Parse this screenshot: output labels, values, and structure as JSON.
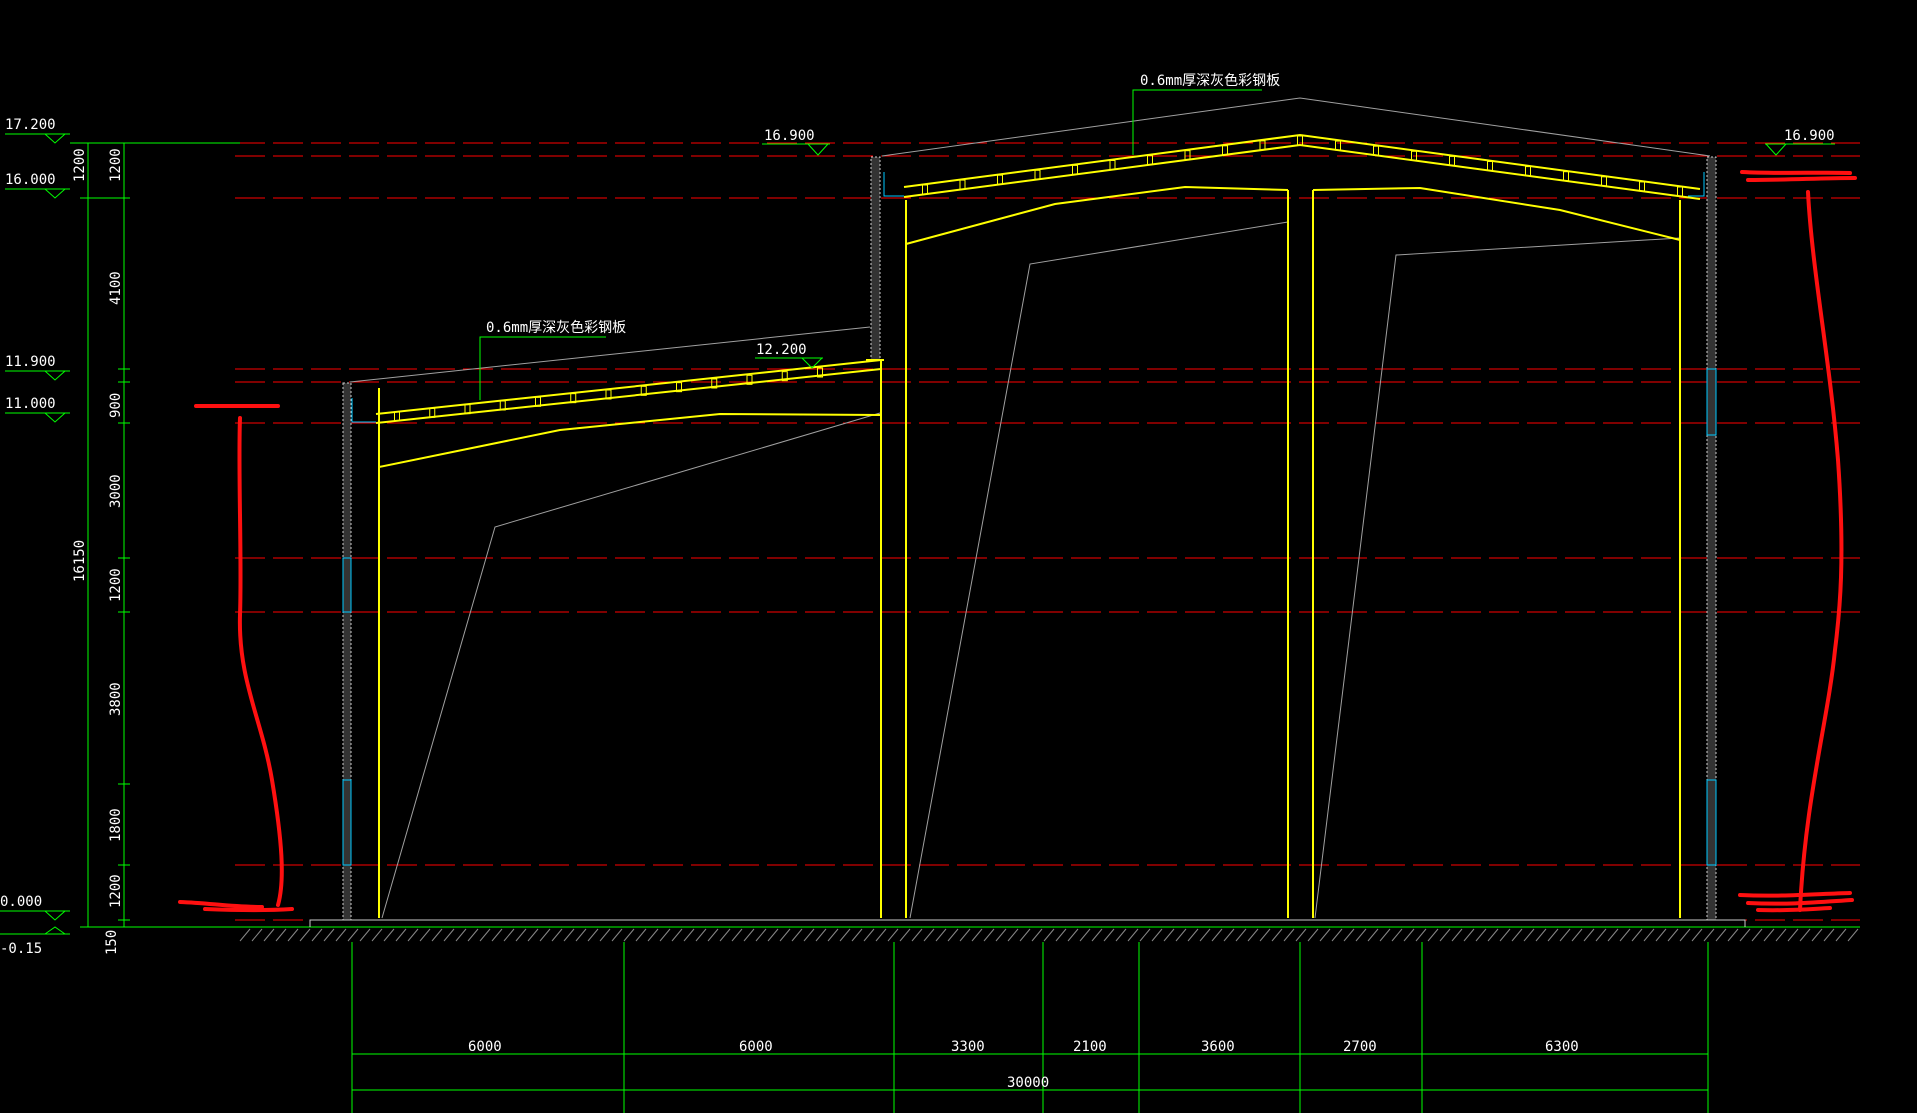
{
  "drawing": {
    "colors": {
      "background": "#000000",
      "frame": "#ffff00",
      "datum": "#ff0000",
      "dimension": "#00ff00",
      "leader": "#a0a0a0",
      "markup": "#ff0000",
      "wall": "#cccccc",
      "gutter": "#00c8ff"
    },
    "elevations_left": [
      "17.200",
      "16.000",
      "11.900",
      "11.000",
      "0.000",
      "-0.15"
    ],
    "elevations_mid": [
      "16.900",
      "12.200"
    ],
    "elevation_right": "16.900",
    "vertical_dims": [
      "1200",
      "1200",
      "4100",
      "900",
      "3000",
      "1200",
      "3800",
      "1800",
      "1200",
      "150"
    ],
    "total_height": "16150",
    "roof_note_low": "0.6mm厚深灰色彩钢板",
    "roof_note_high": "0.6mm厚深灰色彩钢板",
    "horizontal_dims": [
      "6000",
      "6000",
      "3300",
      "2100",
      "3600",
      "2700",
      "6300"
    ],
    "overall_width": "30000"
  }
}
